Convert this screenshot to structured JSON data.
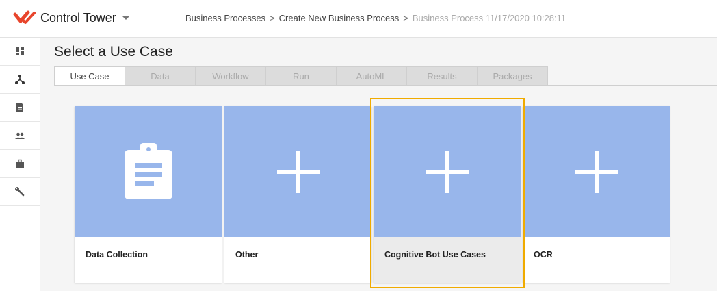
{
  "app": {
    "title": "Control Tower",
    "logo_icon": "control-tower-logo-icon",
    "accent_color": "#e8452c"
  },
  "breadcrumb": [
    {
      "label": "Business Processes"
    },
    {
      "label": "Create New Business Process"
    },
    {
      "label": "Business Process 11/17/2020 10:28:11"
    }
  ],
  "sidebar": {
    "items": [
      {
        "icon": "dashboard-icon"
      },
      {
        "icon": "process-flow-icon"
      },
      {
        "icon": "document-icon"
      },
      {
        "icon": "people-icon"
      },
      {
        "icon": "briefcase-icon"
      },
      {
        "icon": "wrench-icon"
      }
    ]
  },
  "page": {
    "title": "Select a Use Case"
  },
  "tabs": [
    {
      "label": "Use Case",
      "active": true
    },
    {
      "label": "Data",
      "active": false
    },
    {
      "label": "Workflow",
      "active": false
    },
    {
      "label": "Run",
      "active": false
    },
    {
      "label": "AutoML",
      "active": false
    },
    {
      "label": "Results",
      "active": false
    },
    {
      "label": "Packages",
      "active": false
    }
  ],
  "cards": [
    {
      "label": "Data Collection",
      "icon": "clipboard-icon"
    },
    {
      "label": "Other",
      "icon": "plus-icon"
    },
    {
      "label": "Cognitive Bot Use Cases",
      "icon": "plus-icon",
      "selected": true
    },
    {
      "label": "OCR",
      "icon": "plus-icon"
    }
  ],
  "colors": {
    "card_media": "#98b6eb",
    "selection_border": "#f0ab00"
  }
}
